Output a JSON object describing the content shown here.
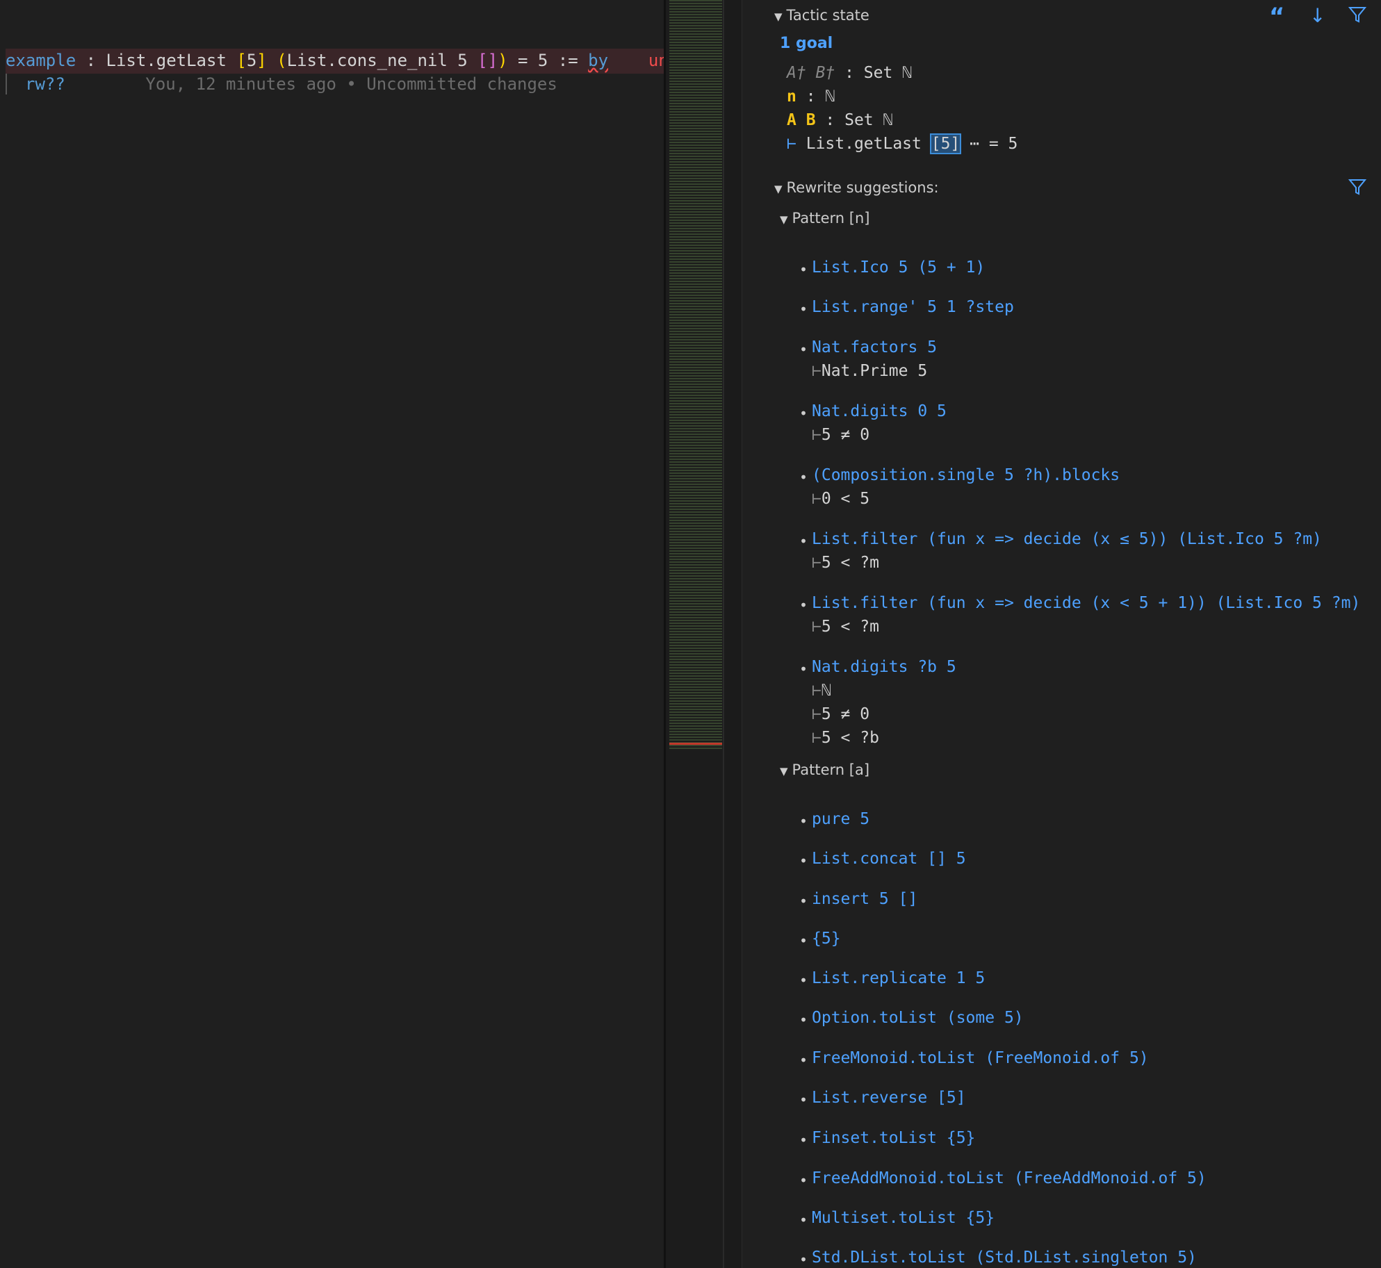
{
  "editor": {
    "line1": {
      "keyword": "example",
      "colon": " : ",
      "name": "List.getLast ",
      "bracket_open": "[",
      "five": "5",
      "bracket_close": "]",
      "paren_open": " (",
      "middle": "List.cons_ne_nil 5 ",
      "empty_list": "[]",
      "paren_close": ")",
      "rest": " = 5 := ",
      "by": "by",
      "error_text": "unsol"
    },
    "line2": {
      "tactic": "rw??",
      "blame": "You, 12 minutes ago • Uncommitted changes"
    }
  },
  "infoview": {
    "tactic_state_title": "Tactic state",
    "goals_count": "1 goal",
    "hyps": [
      {
        "names": "A† B†",
        "sep": " : ",
        "type": "Set ℕ"
      },
      {
        "names": "n",
        "sep": " : ",
        "type": "ℕ"
      },
      {
        "names": "A B",
        "sep": " : ",
        "type": "Set ℕ"
      }
    ],
    "goal": {
      "turnstile": "⊢",
      "prefix": " List.getLast ",
      "highlight": "[5]",
      "suffix": " ⋯ = 5"
    },
    "rewrite_title": "Rewrite suggestions:",
    "toolbar_icons": [
      "quote-icon",
      "arrow-down-icon",
      "filter-icon"
    ],
    "patterns": [
      {
        "title": "Pattern [n]",
        "suggestions": [
          {
            "text": "List.Ico 5 (5 + 1)",
            "side": []
          },
          {
            "text": "List.range' 5 1 ?step",
            "side": []
          },
          {
            "text": "Nat.factors 5",
            "side": [
              "Nat.Prime 5"
            ]
          },
          {
            "text": "Nat.digits 0 5",
            "side": [
              "5 ≠ 0"
            ]
          },
          {
            "text": "(Composition.single 5 ?h).blocks",
            "side": [
              "0 < 5"
            ]
          },
          {
            "text": "List.filter (fun x => decide (x ≤ 5)) (List.Ico 5 ?m)",
            "side": [
              "5 < ?m"
            ]
          },
          {
            "text": "List.filter (fun x => decide (x < 5 + 1)) (List.Ico 5 ?m)",
            "side": [
              "5 < ?m"
            ]
          },
          {
            "text": "Nat.digits ?b 5",
            "side": [
              "ℕ",
              "5 ≠ 0",
              "5 < ?b"
            ]
          }
        ]
      },
      {
        "title": "Pattern [a]",
        "suggestions": [
          {
            "text": "pure 5",
            "side": []
          },
          {
            "text": "List.concat [] 5",
            "side": []
          },
          {
            "text": "insert 5 []",
            "side": []
          },
          {
            "text": "{5}",
            "side": []
          },
          {
            "text": "List.replicate 1 5",
            "side": []
          },
          {
            "text": "Option.toList (some 5)",
            "side": []
          },
          {
            "text": "FreeMonoid.toList (FreeMonoid.of 5)",
            "side": []
          },
          {
            "text": "List.reverse [5]",
            "side": []
          },
          {
            "text": "Finset.toList {5}",
            "side": []
          },
          {
            "text": "FreeAddMonoid.toList (FreeAddMonoid.of 5)",
            "side": []
          },
          {
            "text": "Multiset.toList {5}",
            "side": []
          },
          {
            "text": "Std.DList.toList (Std.DList.singleton 5)",
            "side": []
          }
        ]
      }
    ]
  },
  "colors": {
    "accent": "#4ea1ff",
    "error": "#f14c4c",
    "hyp_name": "#f5c518"
  }
}
